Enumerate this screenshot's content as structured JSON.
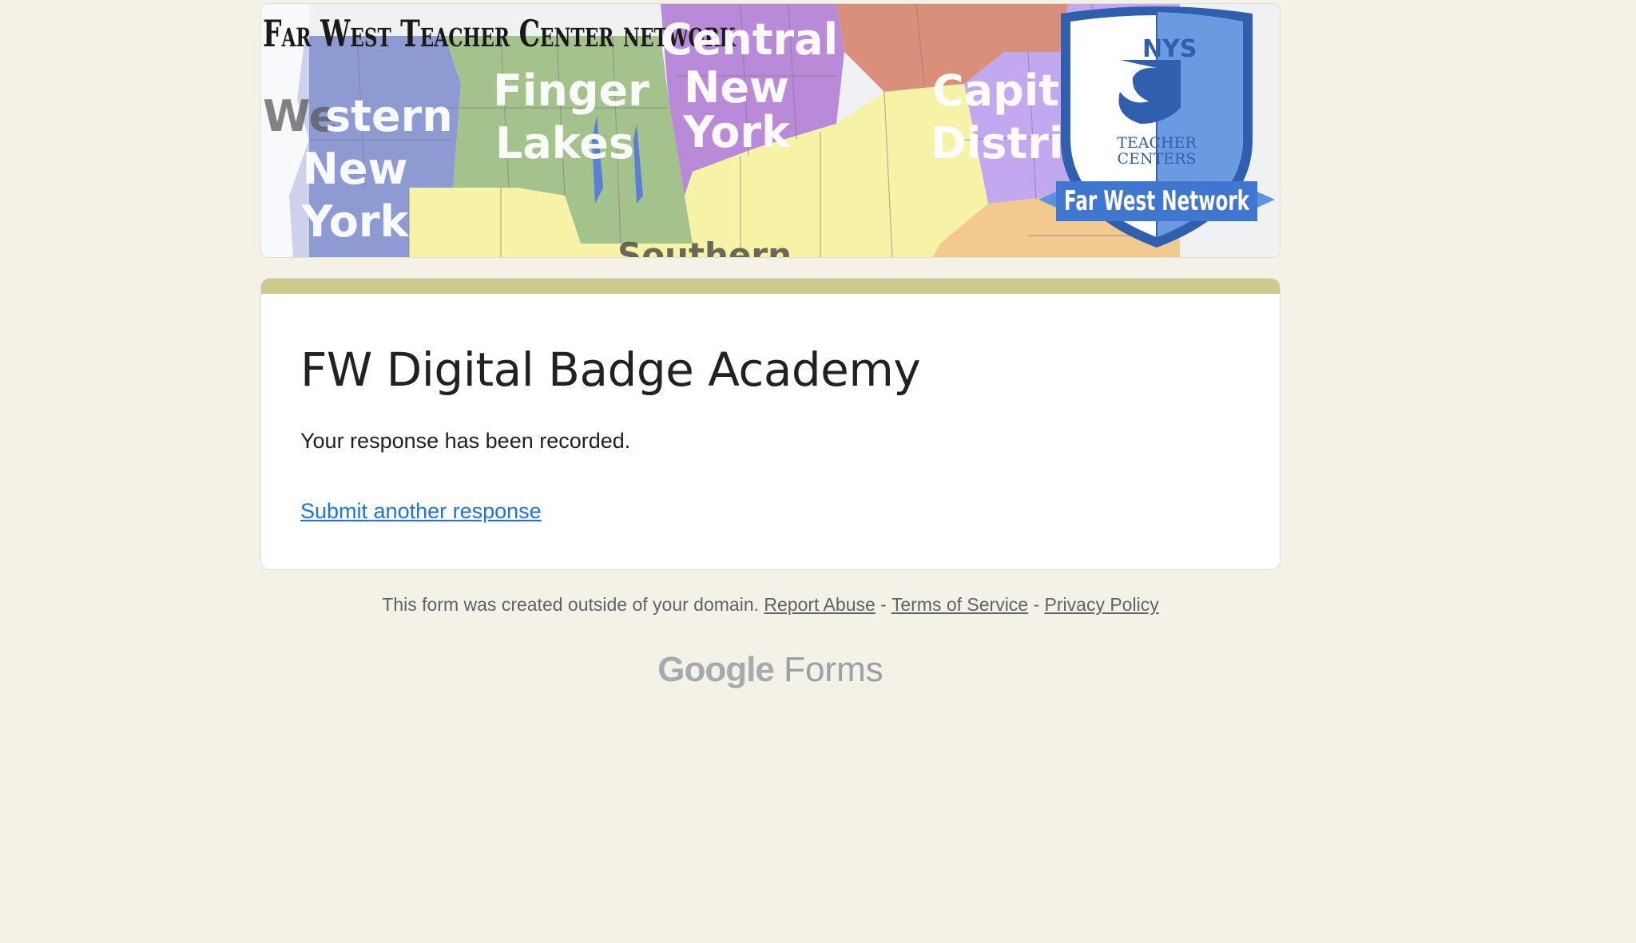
{
  "banner": {
    "title": "Far West Teacher Center network",
    "regions": {
      "western": [
        "We",
        "stern",
        "New",
        "York"
      ],
      "finger_lakes": [
        "Finger",
        "Lakes"
      ],
      "central": [
        "Central",
        "New",
        "York"
      ],
      "capital": [
        "Capit",
        "Distric"
      ],
      "southern": "Southern Tier"
    },
    "logo": {
      "nys": "NYS",
      "teacher_centers_1": "TEACHER",
      "teacher_centers_2": "CENTERS",
      "ribbon": "Far West Network"
    }
  },
  "form": {
    "title": "FW Digital Badge Academy",
    "message": "Your response has been recorded.",
    "submit_another": "Submit another response"
  },
  "footer": {
    "text": "This form was created outside of your domain.",
    "report_abuse": "Report Abuse",
    "sep": "-",
    "terms": "Terms of Service",
    "privacy": "Privacy Policy"
  },
  "brand": {
    "google": "Google",
    "forms": "Forms"
  },
  "colors": {
    "background": "#f4f2e6",
    "accent": "#cdc98b",
    "link": "#1a73e8"
  }
}
